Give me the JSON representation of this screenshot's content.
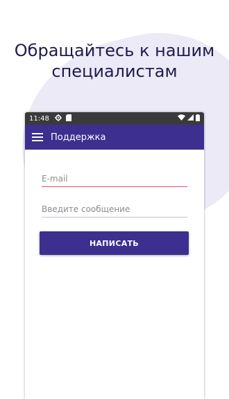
{
  "headline": "Обращайтесь к нашим\nспециалистам",
  "statusbar": {
    "time": "11:48",
    "icons": [
      "gear-icon",
      "sd-card-icon",
      "wifi-icon",
      "signal-icon",
      "battery-icon"
    ]
  },
  "appbar": {
    "title": "Поддержка",
    "menu_icon": "hamburger-menu-icon"
  },
  "form": {
    "email_placeholder": "E-mail",
    "email_value": "",
    "message_placeholder": "Введите сообщение",
    "message_value": "",
    "submit_label": "НАПИСАТЬ"
  },
  "colors": {
    "primary": "#3c2f8f",
    "headline": "#1f1b4d",
    "accent_underline": "#e0506f",
    "blob": "#eceaf7",
    "statusbar": "#3a3a3a"
  }
}
